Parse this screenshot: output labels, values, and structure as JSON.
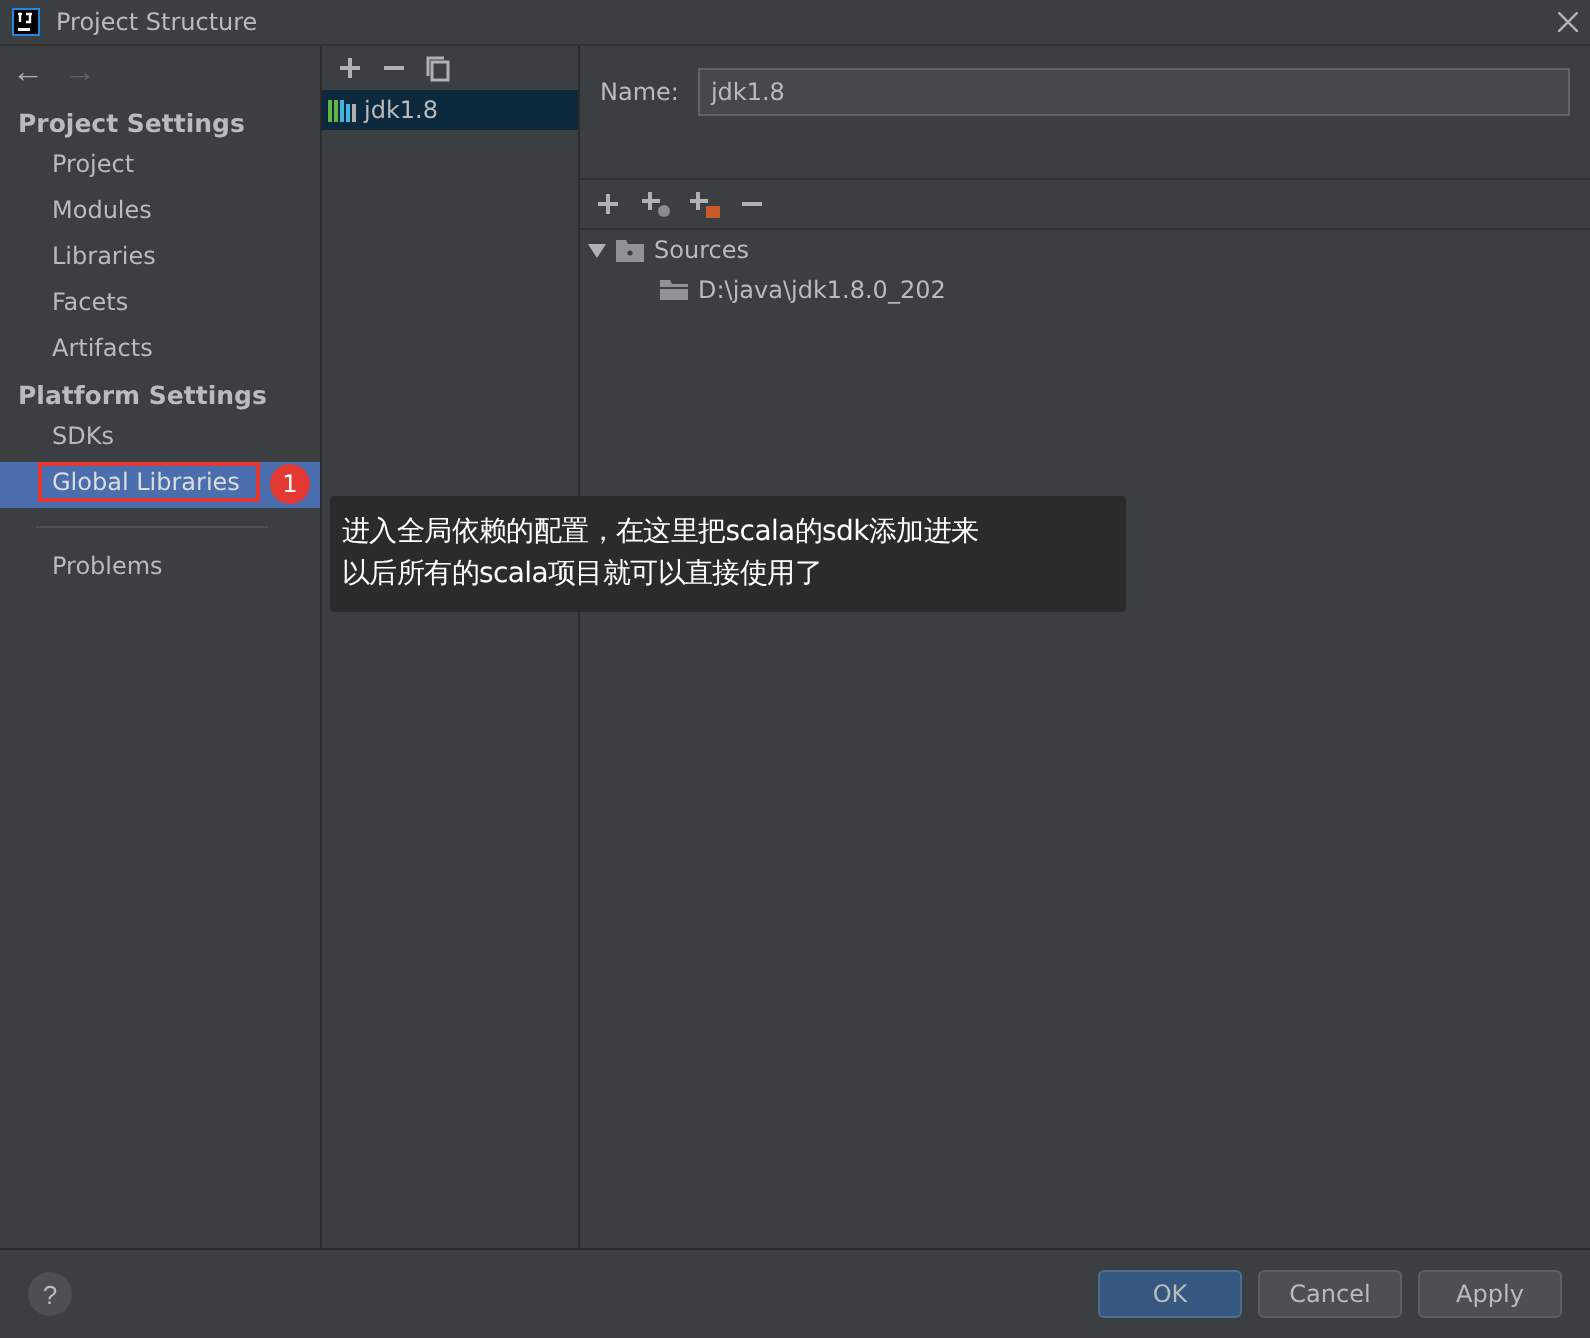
{
  "window": {
    "title": "Project Structure"
  },
  "nav": {
    "back": "←",
    "forward": "→"
  },
  "sidebar": {
    "sections": [
      {
        "heading": "Project Settings",
        "items": [
          {
            "label": "Project",
            "selected": false
          },
          {
            "label": "Modules",
            "selected": false
          },
          {
            "label": "Libraries",
            "selected": false
          },
          {
            "label": "Facets",
            "selected": false
          },
          {
            "label": "Artifacts",
            "selected": false
          }
        ]
      },
      {
        "heading": "Platform Settings",
        "items": [
          {
            "label": "SDKs",
            "selected": false
          },
          {
            "label": "Global Libraries",
            "selected": true
          }
        ]
      }
    ],
    "bottom_items": [
      {
        "label": "Problems",
        "selected": false
      }
    ]
  },
  "annotation": {
    "badge": "1",
    "note_lines": [
      "进入全局依赖的配置，在这里把scala的sdk添加进来",
      "以后所有的scala项目就可以直接使用了"
    ]
  },
  "library_list": {
    "items": [
      {
        "label": "jdk1.8",
        "selected": true
      }
    ]
  },
  "detail": {
    "name_label": "Name:",
    "name_value": "jdk1.8",
    "tree": [
      {
        "label": "Sources",
        "expanded": true,
        "children": [
          {
            "label": "D:\\java\\jdk1.8.0_202"
          }
        ]
      }
    ]
  },
  "footer": {
    "help": "?",
    "buttons": [
      {
        "label": "OK",
        "primary": true
      },
      {
        "label": "Cancel",
        "primary": false
      },
      {
        "label": "Apply",
        "primary": false
      }
    ]
  }
}
